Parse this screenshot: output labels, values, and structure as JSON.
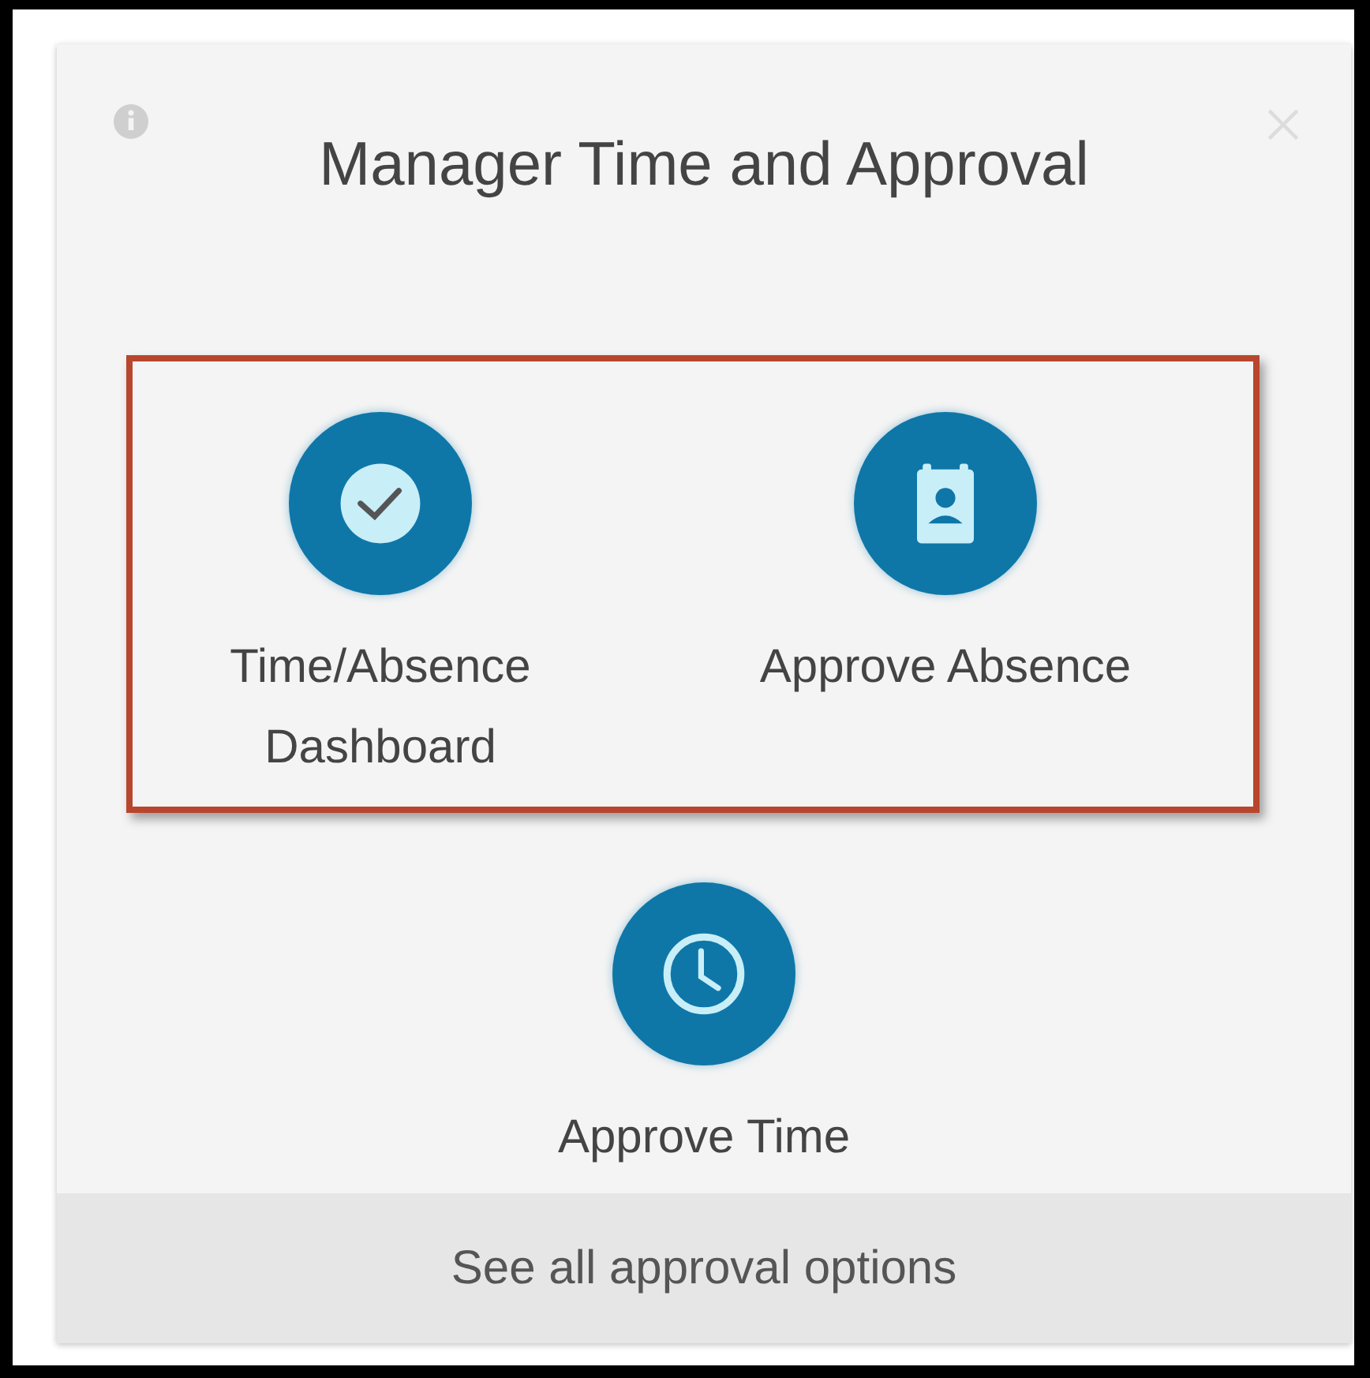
{
  "card": {
    "title": "Manager Time and Approval",
    "highlighted_tiles": [
      {
        "kind": "check",
        "label": "Time/Absence Dashboard"
      },
      {
        "kind": "badge",
        "label": "Approve Absence"
      }
    ],
    "tiles": [
      {
        "kind": "clock",
        "label": "Approve Time"
      }
    ],
    "footer_link": "See all approval options"
  }
}
